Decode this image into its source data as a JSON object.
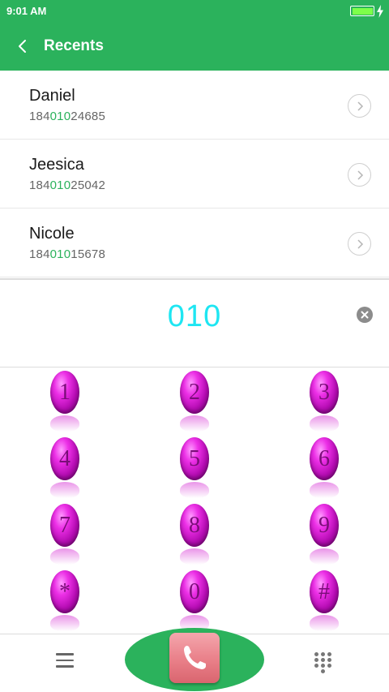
{
  "status_bar": {
    "time": "9:01 AM"
  },
  "header": {
    "title": "Recents",
    "back_icon": "chevron-left-icon"
  },
  "recents": [
    {
      "name": "Daniel",
      "number_prefix": "184",
      "number_match": "010",
      "number_suffix": "24685"
    },
    {
      "name": "Jeesica",
      "number_prefix": "184",
      "number_match": "010",
      "number_suffix": "25042"
    },
    {
      "name": "Nicole",
      "number_prefix": "184",
      "number_match": "010",
      "number_suffix": "15678"
    }
  ],
  "dialer": {
    "dialed_number": "010",
    "clear_icon": "clear-x-icon"
  },
  "keypad": [
    "1",
    "2",
    "3",
    "4",
    "5",
    "6",
    "7",
    "8",
    "9",
    "*",
    "0",
    "#"
  ],
  "bottom_bar": {
    "menu_icon": "menu-icon",
    "call_icon": "phone-icon",
    "dialpad_icon": "dialpad-icon"
  },
  "colors": {
    "brand": "#2bb25c",
    "match": "#2bb25c",
    "dialed": "#1ee6f2",
    "key": "#ec2fe6",
    "call_button": "#e97f88"
  }
}
